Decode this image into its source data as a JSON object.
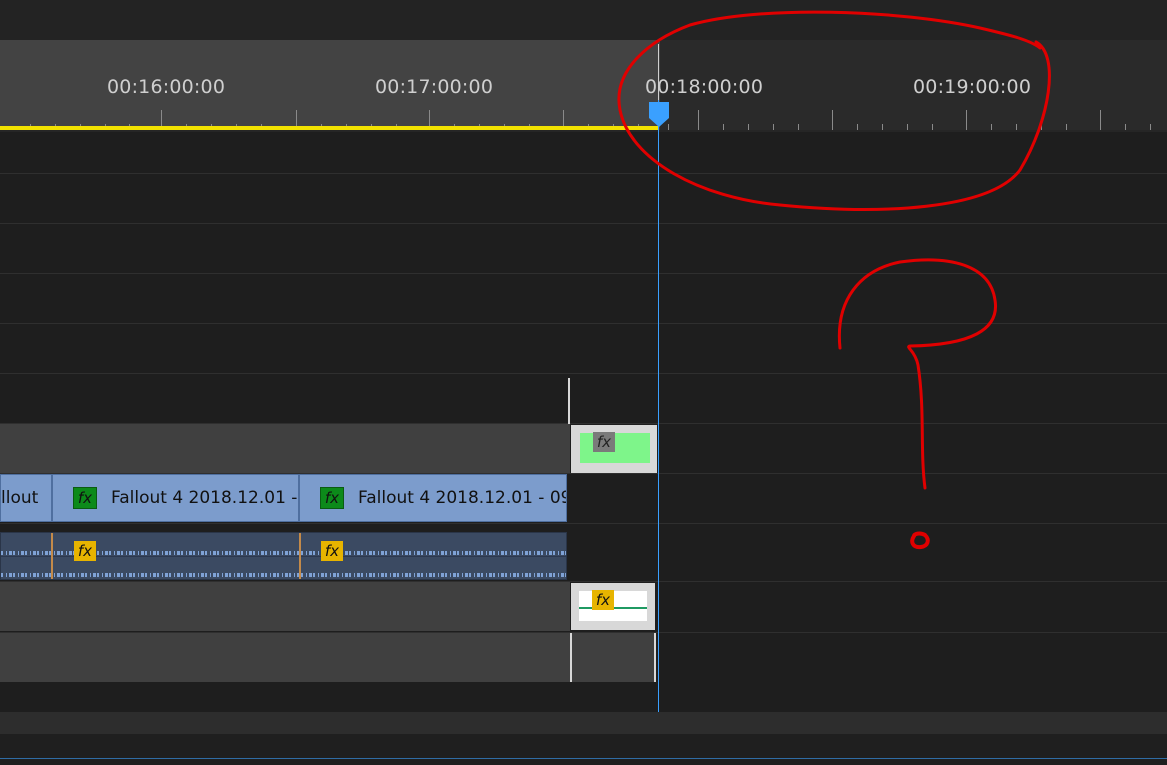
{
  "timeline": {
    "timecodes": [
      "00:16:00:00",
      "00:17:00:00",
      "00:18:00:00",
      "00:19:00:00"
    ],
    "video_clips": [
      {
        "label": "llout",
        "fx": ""
      },
      {
        "label": "Fallout 4 2018.12.01 -",
        "fx": "fx"
      },
      {
        "label": "Fallout 4 2018.12.01 - 09.",
        "fx": "fx"
      }
    ],
    "audio_fx": [
      "fx",
      "fx"
    ],
    "small_clip_fx": [
      "fx",
      "fx"
    ],
    "colors": {
      "playhead": "#3aa0ff",
      "work_area_bar": "#f2e200",
      "video_clip": "#7c9ccc",
      "audio_clip": "#3b4a62",
      "annotation": "#e00000"
    }
  },
  "annotations": {
    "icons": [
      "circle-annotation",
      "question-mark-annotation"
    ]
  }
}
